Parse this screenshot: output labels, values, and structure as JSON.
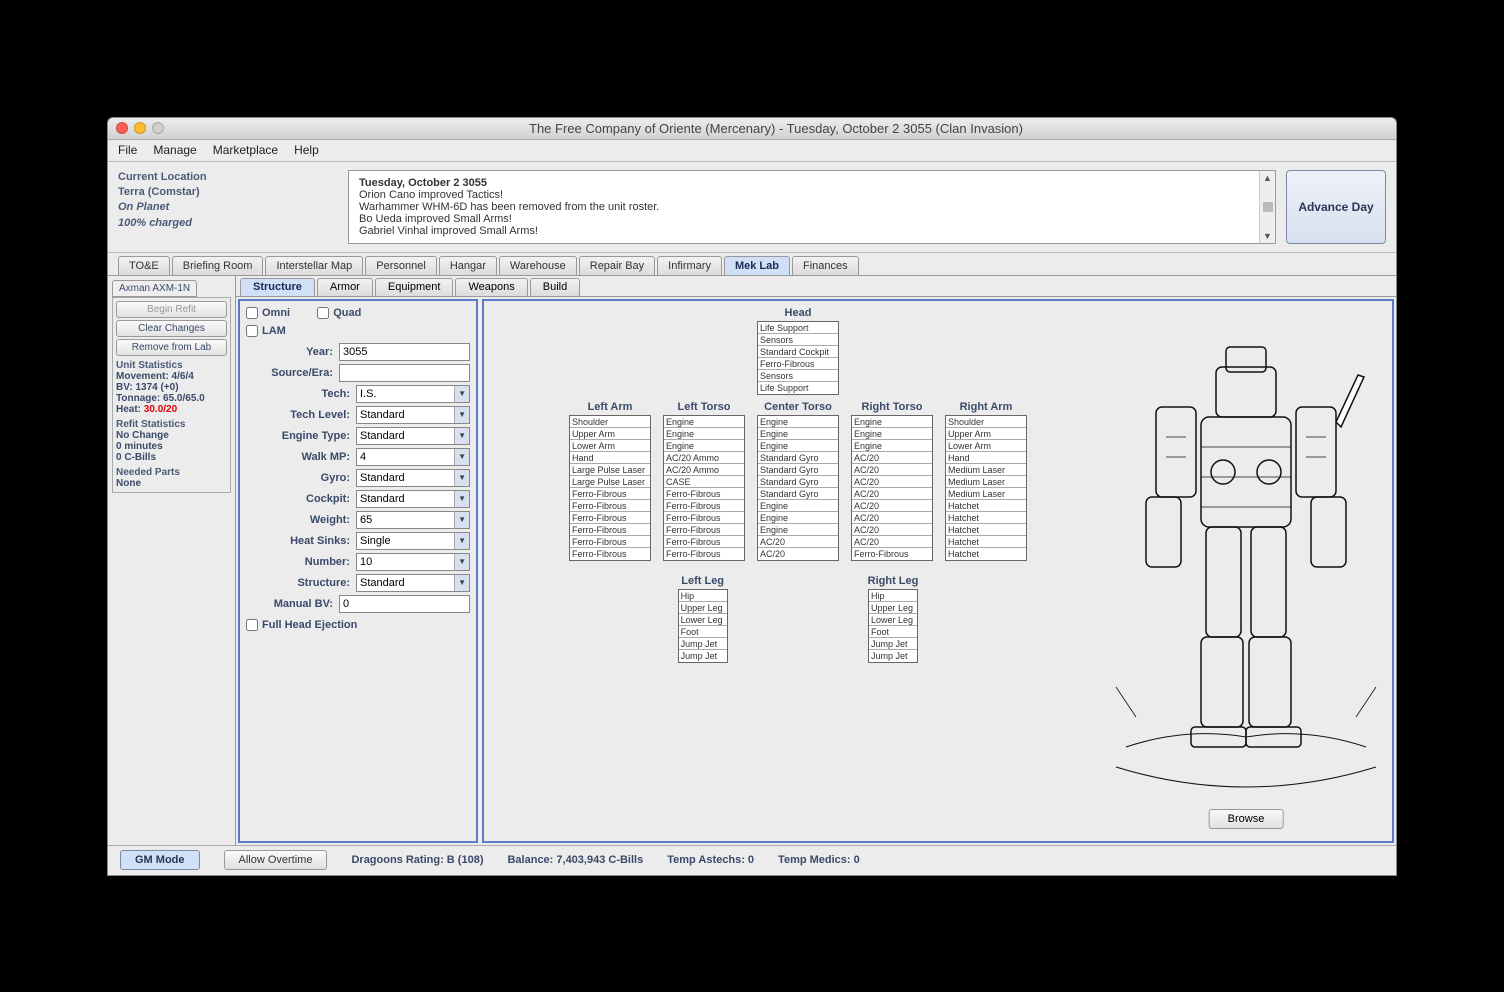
{
  "window": {
    "title": "The Free Company of Oriente (Mercenary) - Tuesday, October 2 3055 (Clan Invasion)"
  },
  "menu": [
    "File",
    "Manage",
    "Marketplace",
    "Help"
  ],
  "location": {
    "label": "Current Location",
    "planet": "Terra (Comstar)",
    "status": "On Planet",
    "charge": "100% charged"
  },
  "log": {
    "date": "Tuesday, October 2 3055",
    "lines": [
      "Orion Cano improved Tactics!",
      "Warhammer WHM-6D has been removed from the unit roster.",
      "Bo Ueda improved Small Arms!",
      "Gabriel Vinhal improved Small Arms!"
    ]
  },
  "advance": "Advance Day",
  "mainTabs": [
    "TO&E",
    "Briefing Room",
    "Interstellar Map",
    "Personnel",
    "Hangar",
    "Warehouse",
    "Repair Bay",
    "Infirmary",
    "Mek Lab",
    "Finances"
  ],
  "mainActive": "Mek Lab",
  "unitTab": "Axman AXM-1N",
  "leftButtons": {
    "begin": "Begin Refit",
    "clear": "Clear Changes",
    "remove": "Remove from Lab"
  },
  "unitStats": {
    "header": "Unit Statistics",
    "movement": "Movement: 4/6/4",
    "bv": "BV: 1374 (+0)",
    "tonnage": "Tonnage: 65.0/65.0",
    "heatLabel": "Heat: ",
    "heat": "30.0/20"
  },
  "refit": {
    "header": "Refit Statistics",
    "l1": "No Change",
    "l2": "0 minutes",
    "l3": "0 C-Bills"
  },
  "parts": {
    "header": "Needed Parts",
    "l1": "None"
  },
  "subTabs": [
    "Structure",
    "Armor",
    "Equipment",
    "Weapons",
    "Build"
  ],
  "subActive": "Structure",
  "checks": {
    "omni": "Omni",
    "quad": "Quad",
    "lam": "LAM",
    "fhe": "Full Head Ejection"
  },
  "form": {
    "year": {
      "label": "Year:",
      "val": "3055"
    },
    "source": {
      "label": "Source/Era:",
      "val": ""
    },
    "tech": {
      "label": "Tech:",
      "val": "I.S."
    },
    "techlevel": {
      "label": "Tech Level:",
      "val": "Standard"
    },
    "engine": {
      "label": "Engine Type:",
      "val": "Standard"
    },
    "walk": {
      "label": "Walk MP:",
      "val": "4"
    },
    "gyro": {
      "label": "Gyro:",
      "val": "Standard"
    },
    "cockpit": {
      "label": "Cockpit:",
      "val": "Standard"
    },
    "weight": {
      "label": "Weight:",
      "val": "65"
    },
    "hs": {
      "label": "Heat Sinks:",
      "val": "Single"
    },
    "number": {
      "label": "Number:",
      "val": "10"
    },
    "structure": {
      "label": "Structure:",
      "val": "Standard"
    },
    "mbv": {
      "label": "Manual BV:",
      "val": "0"
    }
  },
  "locs": {
    "head": {
      "title": "Head",
      "slots": [
        "Life Support",
        "Sensors",
        "Standard Cockpit",
        "Ferro-Fibrous",
        "Sensors",
        "Life Support"
      ]
    },
    "la": {
      "title": "Left Arm",
      "slots": [
        "Shoulder",
        "Upper Arm",
        "Lower Arm",
        "Hand",
        "Large Pulse Laser",
        "Large Pulse Laser",
        "Ferro-Fibrous",
        "Ferro-Fibrous",
        "Ferro-Fibrous",
        "Ferro-Fibrous",
        "Ferro-Fibrous",
        "Ferro-Fibrous"
      ]
    },
    "lt": {
      "title": "Left Torso",
      "slots": [
        "Engine",
        "Engine",
        "Engine",
        "AC/20 Ammo",
        "AC/20 Ammo",
        "CASE",
        "Ferro-Fibrous",
        "Ferro-Fibrous",
        "Ferro-Fibrous",
        "Ferro-Fibrous",
        "Ferro-Fibrous",
        "Ferro-Fibrous"
      ]
    },
    "ct": {
      "title": "Center Torso",
      "slots": [
        "Engine",
        "Engine",
        "Engine",
        "Standard Gyro",
        "Standard Gyro",
        "Standard Gyro",
        "Standard Gyro",
        "Engine",
        "Engine",
        "Engine",
        "AC/20",
        "AC/20"
      ]
    },
    "rt": {
      "title": "Right Torso",
      "slots": [
        "Engine",
        "Engine",
        "Engine",
        "AC/20",
        "AC/20",
        "AC/20",
        "AC/20",
        "AC/20",
        "AC/20",
        "AC/20",
        "AC/20",
        "Ferro-Fibrous"
      ]
    },
    "ra": {
      "title": "Right Arm",
      "slots": [
        "Shoulder",
        "Upper Arm",
        "Lower Arm",
        "Hand",
        "Medium Laser",
        "Medium Laser",
        "Medium Laser",
        "Hatchet",
        "Hatchet",
        "Hatchet",
        "Hatchet",
        "Hatchet"
      ]
    },
    "ll": {
      "title": "Left Leg",
      "slots": [
        "Hip",
        "Upper Leg",
        "Lower Leg",
        "Foot",
        "Jump Jet",
        "Jump Jet"
      ]
    },
    "rl": {
      "title": "Right Leg",
      "slots": [
        "Hip",
        "Upper Leg",
        "Lower Leg",
        "Foot",
        "Jump Jet",
        "Jump Jet"
      ]
    }
  },
  "browse": "Browse",
  "status": {
    "gm": "GM Mode",
    "ot": "Allow Overtime",
    "dragoons": "Dragoons Rating: B (108)",
    "balance": "Balance: 7,403,943 C-Bills",
    "astechs": "Temp Astechs: 0",
    "medics": "Temp Medics: 0"
  }
}
